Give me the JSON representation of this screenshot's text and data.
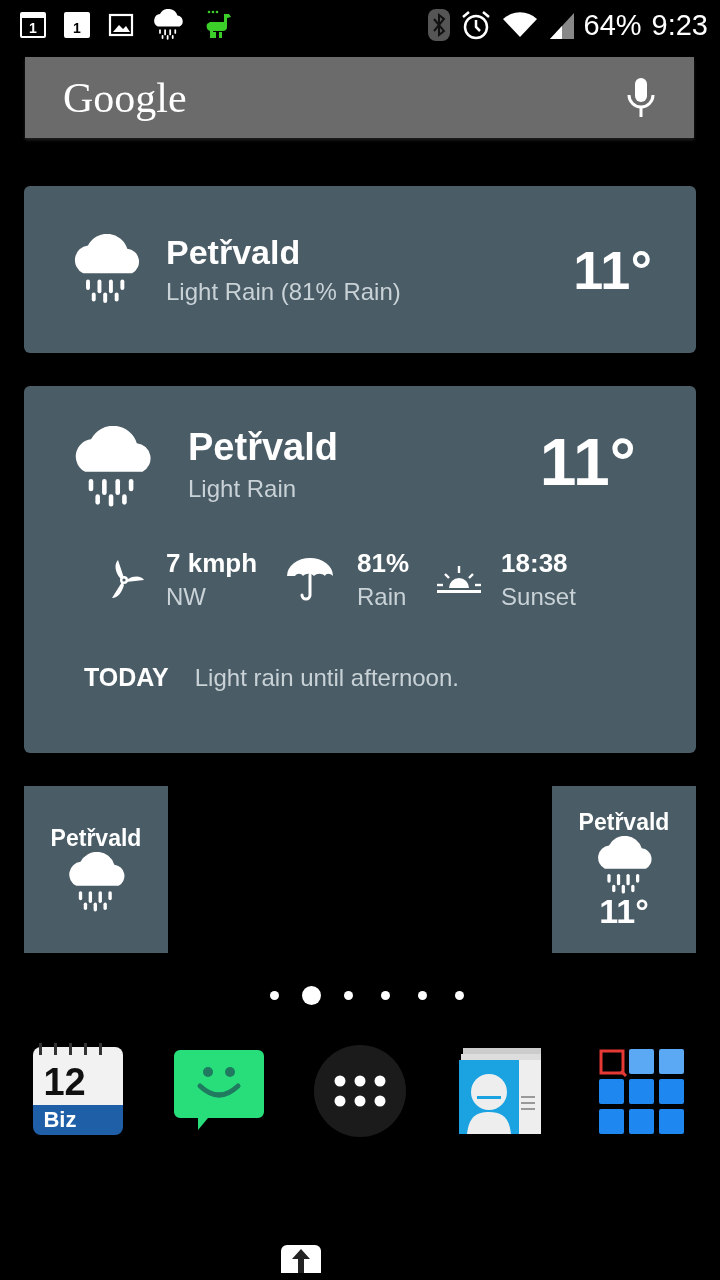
{
  "status_bar": {
    "notifications": [
      {
        "kind": "calendar",
        "label": "1"
      },
      {
        "kind": "calendar_filled",
        "label": "1"
      },
      {
        "kind": "image"
      },
      {
        "kind": "rain"
      },
      {
        "kind": "llama"
      }
    ],
    "battery": "64%",
    "time": "9:23"
  },
  "search": {
    "logo": "Google"
  },
  "weather_small": {
    "city": "Petřvald",
    "condition": "Light Rain (81% Rain)",
    "temp": "11°"
  },
  "weather_large": {
    "city": "Petřvald",
    "condition": "Light Rain",
    "temp": "11°",
    "details": [
      {
        "kind": "wind",
        "value": "7 kmph",
        "label": "NW"
      },
      {
        "kind": "umbrella",
        "value": "81%",
        "label": "Rain"
      },
      {
        "kind": "sunset",
        "value": "18:38",
        "label": "Sunset"
      }
    ],
    "today_label": "TODAY",
    "today_text": "Light rain until afternoon."
  },
  "mini_widgets": [
    {
      "city": "Petřvald"
    },
    {
      "city": "Petřvald",
      "temp": "11°"
    }
  ],
  "page_dots": [
    {
      "selected": false
    },
    {
      "selected": true
    },
    {
      "selected": false
    },
    {
      "selected": false
    },
    {
      "selected": false
    },
    {
      "selected": false
    }
  ],
  "dock": [
    {
      "kind": "calendar",
      "number": "12",
      "label": "Biz"
    },
    {
      "kind": "messages"
    },
    {
      "kind": "apps"
    },
    {
      "kind": "contacts"
    },
    {
      "kind": "grid"
    }
  ]
}
